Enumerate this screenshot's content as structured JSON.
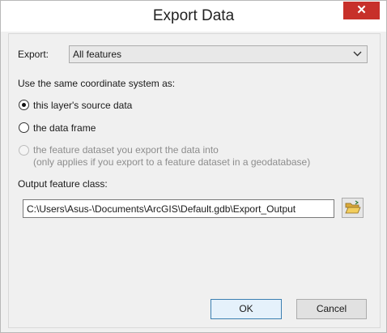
{
  "window": {
    "title": "Export Data",
    "close_glyph": "✕"
  },
  "export": {
    "label": "Export:",
    "selected": "All features",
    "dropdown_icon": "chevron-down-icon"
  },
  "coordinate": {
    "heading": "Use the same coordinate system as:",
    "options": [
      {
        "label": "this layer's source data",
        "checked": true,
        "enabled": true
      },
      {
        "label": "the data frame",
        "checked": false,
        "enabled": true
      },
      {
        "label": "the feature dataset you export the data into",
        "sublabel": "(only applies if you export to a feature dataset in a geodatabase)",
        "checked": false,
        "enabled": false
      }
    ]
  },
  "output": {
    "label": "Output feature class:",
    "value": "C:\\Users\\Asus-\\Documents\\ArcGIS\\Default.gdb\\Export_Output",
    "browse_icon": "folder-open-icon"
  },
  "buttons": {
    "ok": "OK",
    "cancel": "Cancel"
  },
  "colors": {
    "close": "#c7302a",
    "default_button_border": "#3c7fb1"
  }
}
